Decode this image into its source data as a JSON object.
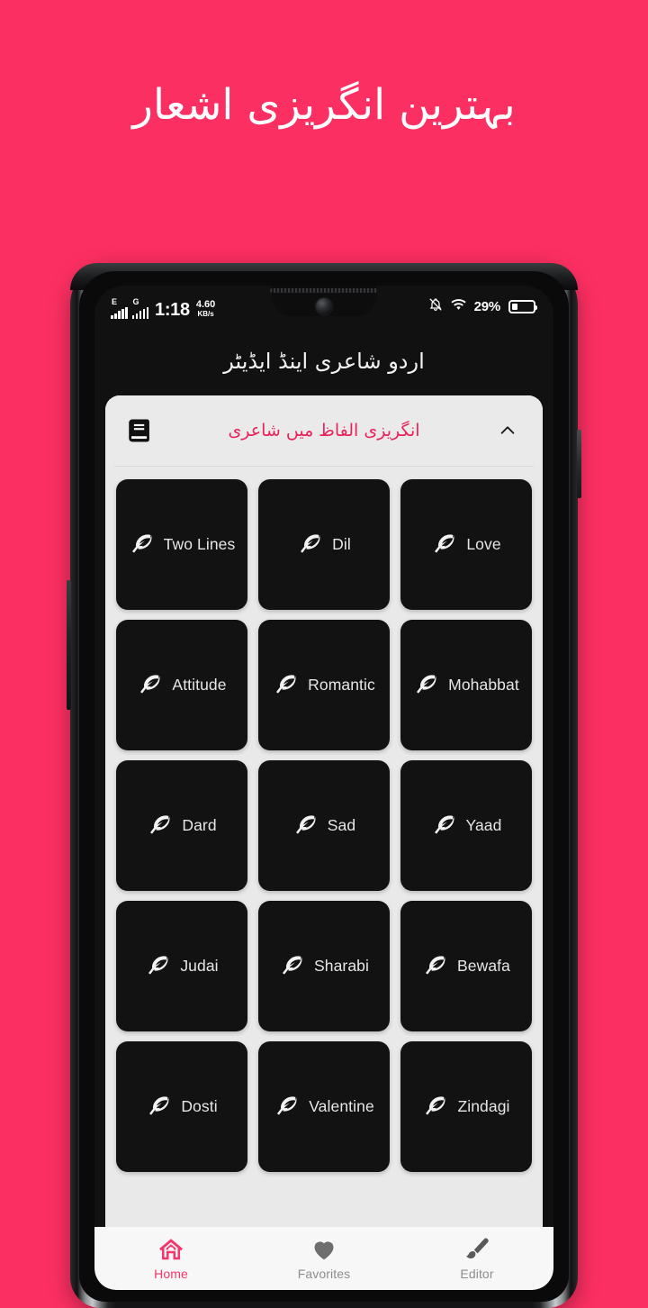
{
  "promo": {
    "headline": "بہترین انگریزی اشعار",
    "background_color": "#fc2f62"
  },
  "phone": {
    "status_bar": {
      "signal_1_label": "E",
      "signal_2_label": "G",
      "time": "1:18",
      "network_speed_value": "4.60",
      "network_speed_unit": "KB/s",
      "notification_icon": "bell-off-icon",
      "wifi_icon": "wifi-icon",
      "battery_percent": "29%",
      "battery_level": 29
    },
    "app": {
      "title": "اردو شاعری اینڈ ایڈیٹر",
      "accent_color": "#e8235c",
      "category_header": {
        "book_icon": "book-icon",
        "title": "انگریزی الفاظ میں شاعری",
        "expand_icon": "chevron-up-icon"
      },
      "tiles": [
        {
          "label": "Two Lines",
          "icon": "feather-icon"
        },
        {
          "label": "Dil",
          "icon": "feather-icon"
        },
        {
          "label": "Love",
          "icon": "feather-icon"
        },
        {
          "label": "Attitude",
          "icon": "feather-icon"
        },
        {
          "label": "Romantic",
          "icon": "feather-icon"
        },
        {
          "label": "Mohabbat",
          "icon": "feather-icon"
        },
        {
          "label": "Dard",
          "icon": "feather-icon"
        },
        {
          "label": "Sad",
          "icon": "feather-icon"
        },
        {
          "label": "Yaad",
          "icon": "feather-icon"
        },
        {
          "label": "Judai",
          "icon": "feather-icon"
        },
        {
          "label": "Sharabi",
          "icon": "feather-icon"
        },
        {
          "label": "Bewafa",
          "icon": "feather-icon"
        },
        {
          "label": "Dosti",
          "icon": "feather-icon"
        },
        {
          "label": "Valentine",
          "icon": "feather-icon"
        },
        {
          "label": "Zindagi",
          "icon": "feather-icon"
        }
      ],
      "bottom_nav": [
        {
          "label": "Home",
          "icon": "home-icon",
          "active": true
        },
        {
          "label": "Favorites",
          "icon": "heart-icon",
          "active": false
        },
        {
          "label": "Editor",
          "icon": "brush-icon",
          "active": false
        }
      ]
    }
  }
}
